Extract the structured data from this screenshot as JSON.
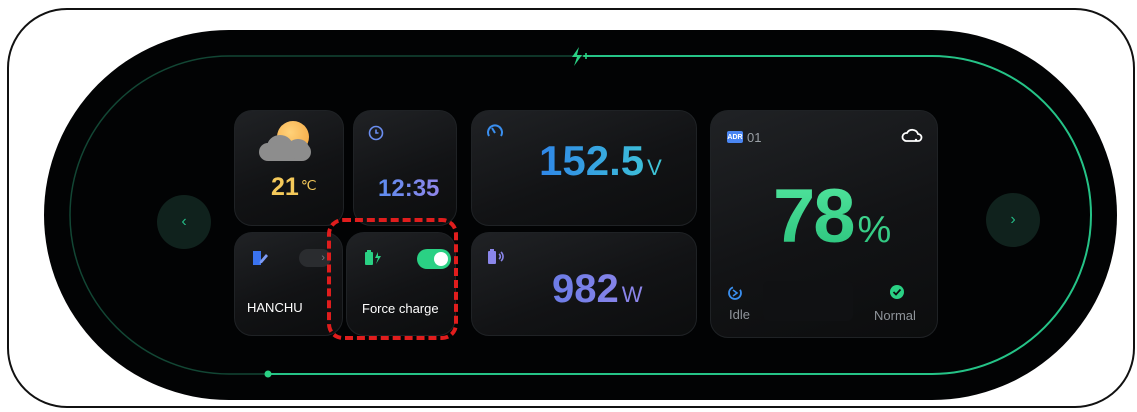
{
  "weather": {
    "temperature": "21",
    "unit": "℃",
    "icon": "sun-behind-cloud-icon"
  },
  "clock": {
    "time": "12:35",
    "icon": "clock-icon"
  },
  "voltage": {
    "value": "152.5",
    "unit": "V",
    "icon": "gauge-icon"
  },
  "power": {
    "value": "982",
    "unit": "W",
    "icon": "battery-power-icon"
  },
  "battery": {
    "adr_badge": "ADR",
    "adr_number": "01",
    "soc": "78",
    "soc_unit": "%",
    "cloud_status_icon": "cloud-wifi-icon",
    "state_label": "Idle",
    "health_label": "Normal"
  },
  "hanchu": {
    "label": "HANCHU",
    "chevron": "›"
  },
  "force_charge": {
    "label": "Force charge",
    "enabled": true
  },
  "nav": {
    "prev": "‹",
    "next": "›"
  },
  "colors": {
    "accent": "#2ad184",
    "highlight": "#e01d1d",
    "voltage": "#2f86e8",
    "soc": "#54e8a0"
  }
}
